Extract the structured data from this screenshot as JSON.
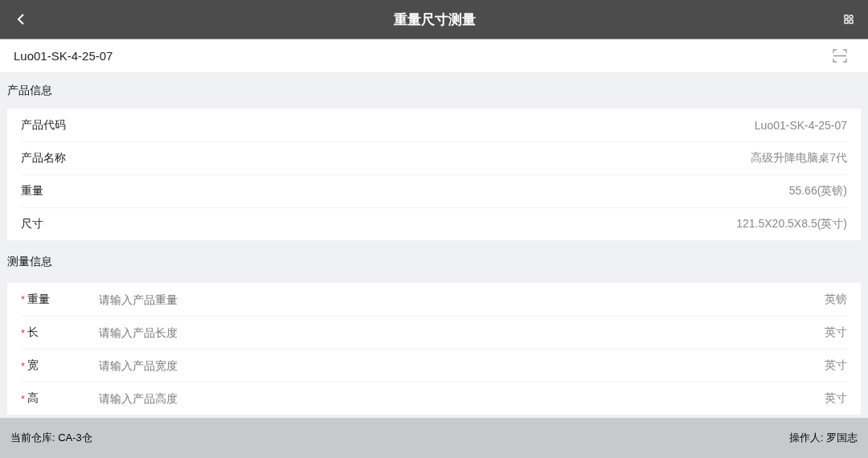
{
  "header": {
    "title": "重量尺寸测量"
  },
  "scan": {
    "value": "Luo01-SK-4-25-07"
  },
  "product_section": {
    "title": "产品信息",
    "rows": [
      {
        "label": "产品代码",
        "value": "Luo01-SK-4-25-07"
      },
      {
        "label": "产品名称",
        "value": "高级升降电脑桌7代"
      },
      {
        "label": "重量",
        "value": "55.66(英镑)"
      },
      {
        "label": "尺寸",
        "value": "121.5X20.5X8.5(英寸)"
      }
    ]
  },
  "measure_section": {
    "title": "测量信息",
    "fields": [
      {
        "label": "重量",
        "required": true,
        "required_mark": "*",
        "placeholder": "请输入产品重量",
        "unit": "英镑"
      },
      {
        "label": "长",
        "required": true,
        "required_mark": "*",
        "placeholder": "请输入产品长度",
        "unit": "英寸"
      },
      {
        "label": "宽",
        "required": true,
        "required_mark": "*",
        "placeholder": "请输入产品宽度",
        "unit": "英寸"
      },
      {
        "label": "高",
        "required": true,
        "required_mark": "*",
        "placeholder": "请输入产品高度",
        "unit": "英寸"
      }
    ]
  },
  "status_bar": {
    "warehouse": "当前仓库: CA-3仓",
    "operator": "操作人: 罗国志"
  }
}
